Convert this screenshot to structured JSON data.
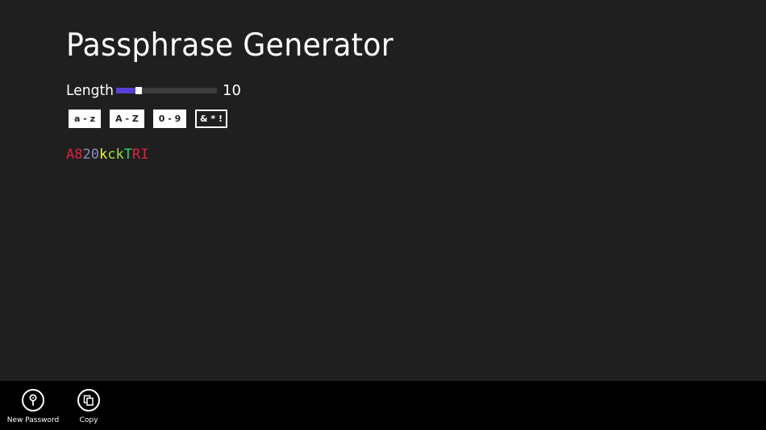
{
  "app": {
    "title": "Passphrase Generator"
  },
  "length": {
    "label": "Length",
    "value": "10",
    "slider_fraction": 0.19
  },
  "charsets": [
    {
      "label": "a - z",
      "active": true
    },
    {
      "label": "A - Z",
      "active": true
    },
    {
      "label": "0 - 9",
      "active": true
    },
    {
      "label": "& * !",
      "active": false
    }
  ],
  "password": {
    "chars": [
      {
        "ch": "A",
        "color": "#e0213f"
      },
      {
        "ch": "8",
        "color": "#e0213f"
      },
      {
        "ch": "2",
        "color": "#8e8ab8"
      },
      {
        "ch": "0",
        "color": "#8e8ab8"
      },
      {
        "ch": "k",
        "color": "#f2f03a"
      },
      {
        "ch": "c",
        "color": "#9be13c"
      },
      {
        "ch": "k",
        "color": "#9be13c"
      },
      {
        "ch": "T",
        "color": "#2bd66a"
      },
      {
        "ch": "R",
        "color": "#e0213f"
      },
      {
        "ch": "I",
        "color": "#e0213f"
      }
    ]
  },
  "appbar": {
    "new_password_label": "New Password",
    "new_password_icon": "key-icon",
    "copy_label": "Copy",
    "copy_icon": "copy-icon"
  },
  "colors": {
    "background": "#1f1f1f",
    "appbar": "#000000",
    "accent": "#5a3fd6"
  }
}
